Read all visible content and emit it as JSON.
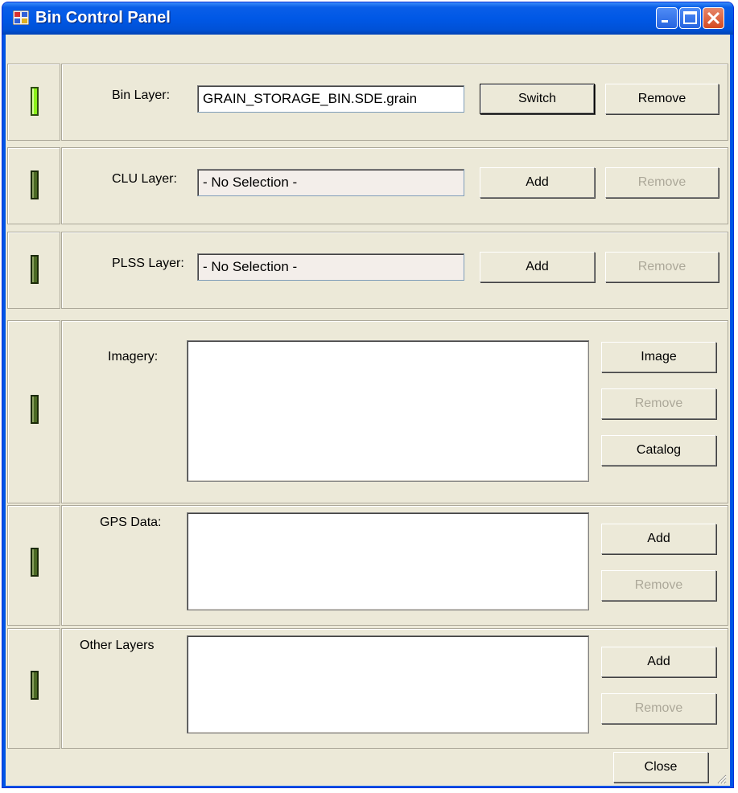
{
  "window": {
    "title": "Bin Control Panel"
  },
  "rows": {
    "bin": {
      "label": "Bin Layer:",
      "value": "GRAIN_STORAGE_BIN.SDE.grain",
      "primary_btn": "Switch",
      "remove_btn": "Remove",
      "status": "active"
    },
    "clu": {
      "label": "CLU Layer:",
      "value": "- No Selection -",
      "primary_btn": "Add",
      "remove_btn": "Remove",
      "status": "inactive"
    },
    "plss": {
      "label": "PLSS Layer:",
      "value": "- No Selection -",
      "primary_btn": "Add",
      "remove_btn": "Remove",
      "status": "inactive"
    },
    "imagery": {
      "label": "Imagery:",
      "image_btn": "Image",
      "remove_btn": "Remove",
      "catalog_btn": "Catalog",
      "status": "inactive"
    },
    "gps": {
      "label": "GPS Data:",
      "add_btn": "Add",
      "remove_btn": "Remove",
      "status": "inactive"
    },
    "other": {
      "label": "Other Layers",
      "add_btn": "Add",
      "remove_btn": "Remove",
      "status": "inactive"
    }
  },
  "footer": {
    "close_btn": "Close"
  },
  "colors": {
    "led_active": "#8cf21a",
    "led_inactive": "#4b6a24",
    "titlebar": "#0058e6",
    "panel_bg": "#ece9d8"
  }
}
